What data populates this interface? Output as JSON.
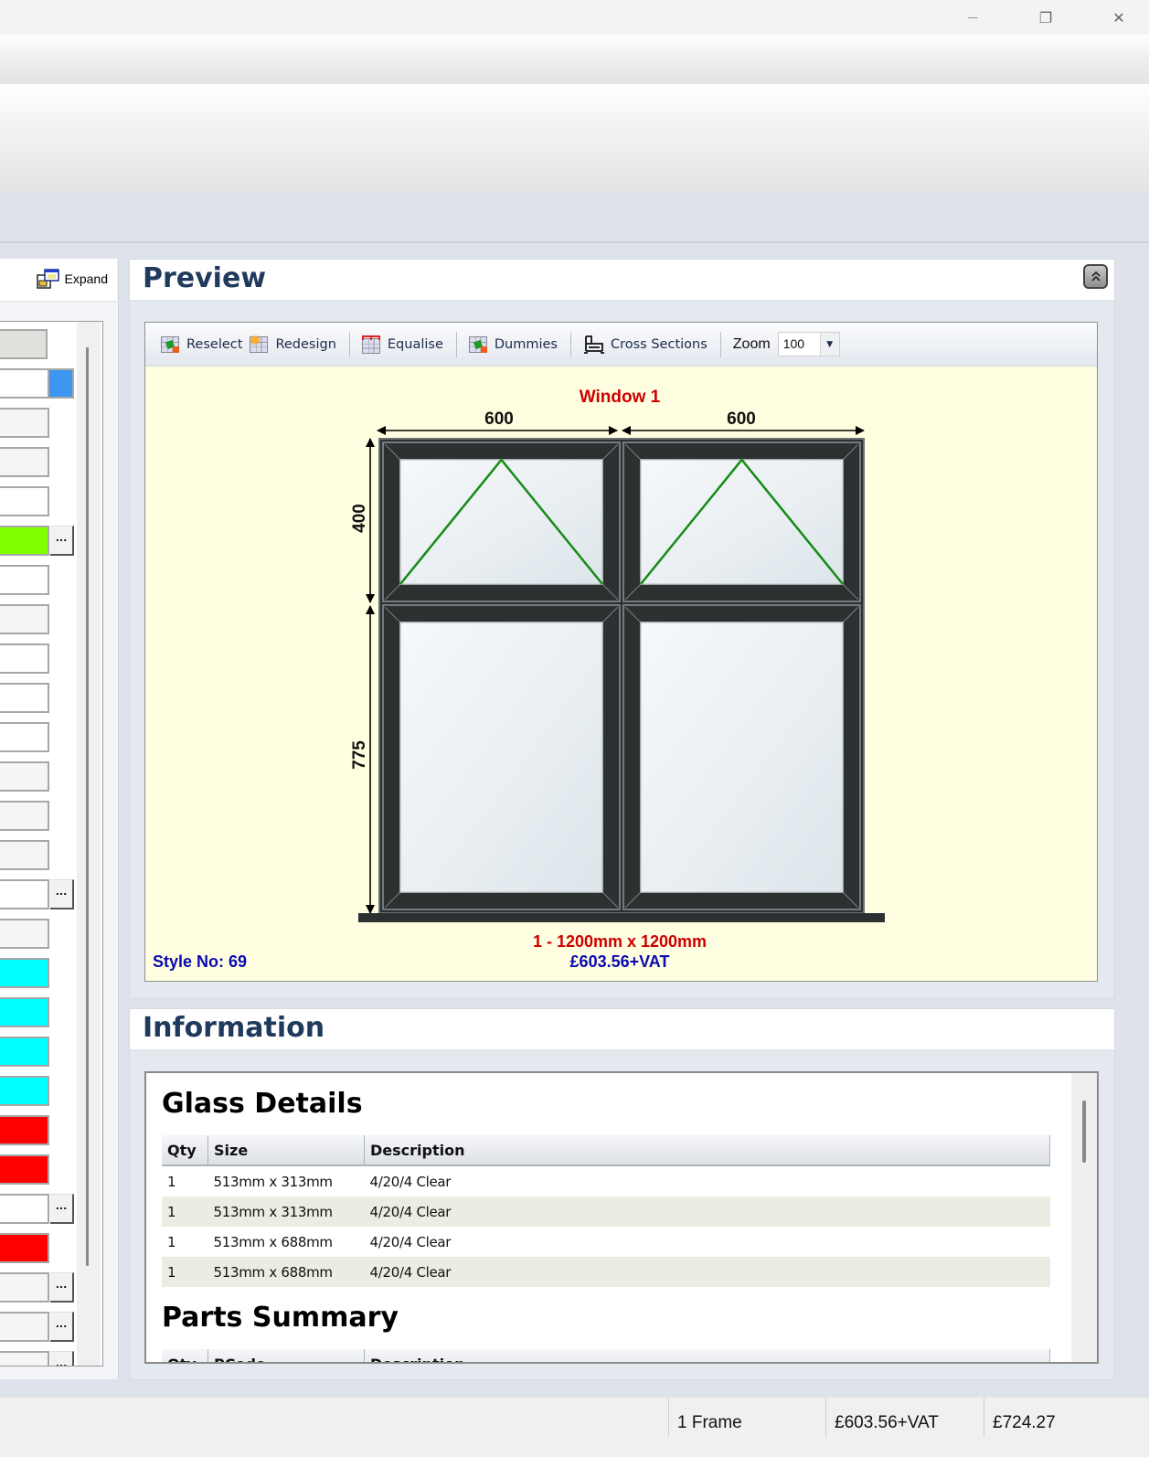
{
  "window": {
    "controls": {
      "minimize": "—",
      "maximize": "❐",
      "close": "✕"
    }
  },
  "left_panel": {
    "expand_label": "Expand",
    "expand_icon": "expand-window-icon",
    "fields": [
      {
        "color": "#e0e0dc",
        "ellipsis": false,
        "accent": ""
      },
      {
        "color": "#ffffff",
        "ellipsis": false,
        "accent": "#3d97f2"
      },
      {
        "color": "#f5f5f5",
        "ellipsis": false,
        "accent": ""
      },
      {
        "color": "#f5f5f5",
        "ellipsis": false,
        "accent": ""
      },
      {
        "color": "#ffffff",
        "ellipsis": false,
        "accent": ""
      },
      {
        "color": "#80ff00",
        "ellipsis": true,
        "accent": ""
      },
      {
        "color": "#ffffff",
        "ellipsis": false,
        "accent": ""
      },
      {
        "color": "#f5f5f5",
        "ellipsis": false,
        "accent": ""
      },
      {
        "color": "#ffffff",
        "ellipsis": false,
        "accent": ""
      },
      {
        "color": "#ffffff",
        "ellipsis": false,
        "accent": ""
      },
      {
        "color": "#ffffff",
        "ellipsis": false,
        "accent": ""
      },
      {
        "color": "#f5f5f5",
        "ellipsis": false,
        "accent": ""
      },
      {
        "color": "#f5f5f5",
        "ellipsis": false,
        "accent": ""
      },
      {
        "color": "#f5f5f5",
        "ellipsis": false,
        "accent": ""
      },
      {
        "color": "#ffffff",
        "ellipsis": true,
        "accent": ""
      },
      {
        "color": "#f5f5f5",
        "ellipsis": false,
        "accent": ""
      },
      {
        "color": "#00ffff",
        "ellipsis": false,
        "accent": ""
      },
      {
        "color": "#00ffff",
        "ellipsis": false,
        "accent": ""
      },
      {
        "color": "#00ffff",
        "ellipsis": false,
        "accent": ""
      },
      {
        "color": "#00ffff",
        "ellipsis": false,
        "accent": ""
      },
      {
        "color": "#ff0000",
        "ellipsis": false,
        "accent": ""
      },
      {
        "color": "#ff0000",
        "ellipsis": false,
        "accent": ""
      },
      {
        "color": "#ffffff",
        "ellipsis": true,
        "accent": ""
      },
      {
        "color": "#ff0000",
        "ellipsis": false,
        "accent": ""
      },
      {
        "color": "#f5f5f5",
        "ellipsis": true,
        "accent": ""
      },
      {
        "color": "#f5f5f5",
        "ellipsis": true,
        "accent": ""
      },
      {
        "color": "#f5f5f5",
        "ellipsis": true,
        "accent": ""
      }
    ],
    "ellipsis_label": "..."
  },
  "preview": {
    "title": "Preview",
    "collapse_icon": "double-chevron-up-icon",
    "toolbar": {
      "reselect": "Reselect",
      "redesign": "Redesign",
      "equalise": "Equalise",
      "dummies": "Dummies",
      "cross_sections": "Cross Sections",
      "zoom_label": "Zoom",
      "zoom_value": "100"
    },
    "drawing": {
      "window_title": "Window 1",
      "widths": [
        "600",
        "600"
      ],
      "heights": [
        "400",
        "775"
      ],
      "size_text": "1 - 1200mm x 1200mm",
      "price_text": "£603.56+VAT",
      "style_text": "Style No: 69",
      "frame_color": "#2b3031",
      "opener_color": "#148c14",
      "background": "#fffee0"
    }
  },
  "information": {
    "title": "Information",
    "glass_details": {
      "title": "Glass Details",
      "columns": [
        "Qty",
        "Size",
        "Description"
      ],
      "rows": [
        [
          "1",
          "513mm x 313mm",
          "4/20/4 Clear"
        ],
        [
          "1",
          "513mm x 313mm",
          "4/20/4 Clear"
        ],
        [
          "1",
          "513mm x 688mm",
          "4/20/4 Clear"
        ],
        [
          "1",
          "513mm x 688mm",
          "4/20/4 Clear"
        ]
      ]
    },
    "parts_summary": {
      "title": "Parts Summary",
      "columns": [
        "Qty",
        "PCode",
        "Description"
      ]
    }
  },
  "status_bar": {
    "frames": "1 Frame",
    "net_price": "£603.56+VAT",
    "gross_price": "£724.27"
  }
}
